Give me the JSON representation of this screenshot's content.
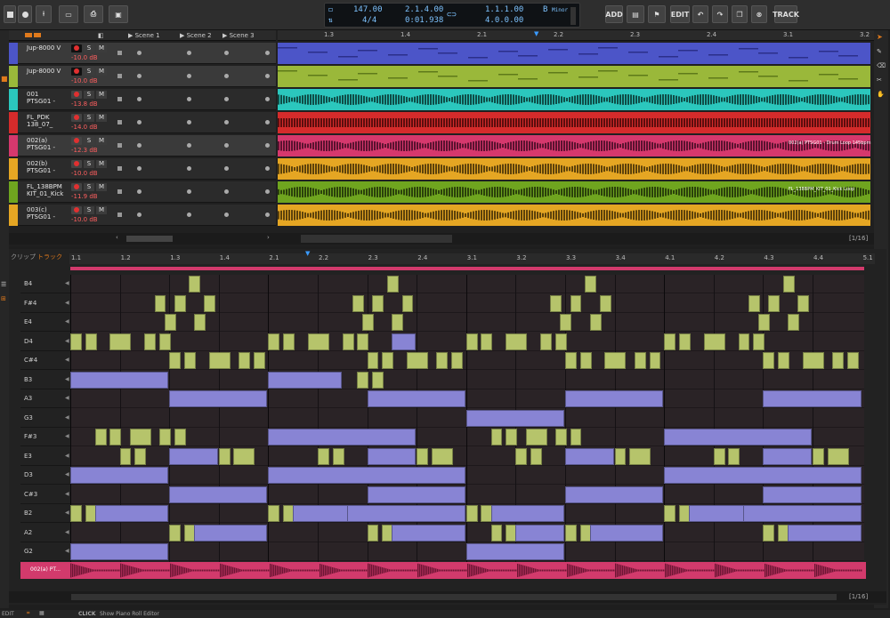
{
  "toolbar": {
    "tempo": "147.00",
    "time_sig": "4/4",
    "position_beats": "2.1.4.00",
    "position_time": "0:01.938",
    "loop_start": "1.1.1.00",
    "loop_length": "4.0.0.00",
    "key": "B",
    "scale": "Minor",
    "add_label": "ADD",
    "edit_label": "EDIT",
    "track_label": "TRACK"
  },
  "scenes": [
    "Scene 1",
    "Scene 2",
    "Scene 3"
  ],
  "tracks": [
    {
      "name": "Jup-8000 V",
      "db": "-10.0 dB",
      "color": "#4c55c8",
      "wave": "#6f76e0"
    },
    {
      "name": "Jup-8000 V",
      "db": "-10.0 dB",
      "color": "#9ab83a",
      "wave": "#c7dc78"
    },
    {
      "name": "001\nPTSG01 -",
      "db": "-13.8 dB",
      "color": "#2bc7bd",
      "wave": "#0f4d47"
    },
    {
      "name": "FL_PDK\n138_07_",
      "db": "-14.0 dB",
      "color": "#d52b2b",
      "wave": "#5d0e0e"
    },
    {
      "name": "002(a)\nPTSG01 -",
      "db": "-12.3 dB",
      "color": "#d6386d",
      "wave": "#5b1230"
    },
    {
      "name": "002(b)\nPTSG01 -",
      "db": "-10.0 dB",
      "color": "#e5a623",
      "wave": "#5d420b"
    },
    {
      "name": "FL_138BPM\nKIT_01_Kick",
      "db": "-11.9 dB",
      "color": "#6fa51f",
      "wave": "#2b420b"
    },
    {
      "name": "003(c)\nPTSG01 -",
      "db": "-10.0 dB",
      "color": "#e5a623",
      "wave": "#5d420b"
    }
  ],
  "arr_ruler": [
    "1.3",
    "1.4",
    "2.1",
    "2.2",
    "2.3",
    "2.4",
    "3.1",
    "3.2"
  ],
  "clip_captions": [
    "002(a) PTSG01 - Drum Loop 145bpm",
    "FL_138BPM_KIT_01_Kick Loop"
  ],
  "zoom_label": "[1/16]",
  "editor": {
    "tab_clip": "クリップ",
    "tab_track": "トラック",
    "ruler": [
      "1.1",
      "1.2",
      "1.3",
      "1.4",
      "2.1",
      "2.2",
      "2.3",
      "2.4",
      "3.1",
      "3.2",
      "3.3",
      "3.4",
      "4.1",
      "4.2",
      "4.3",
      "4.4",
      "5.1"
    ],
    "keys": [
      "B4",
      "F#4",
      "E4",
      "D4",
      "C#4",
      "B3",
      "A3",
      "G3",
      "F#3",
      "E3",
      "D3",
      "C#3",
      "B2",
      "A2",
      "G2"
    ],
    "audio_track": "002(a) PT..."
  },
  "status": {
    "mode": "EDIT",
    "hint_key": "CLICK",
    "hint": "Show Piano Roll Editor"
  }
}
